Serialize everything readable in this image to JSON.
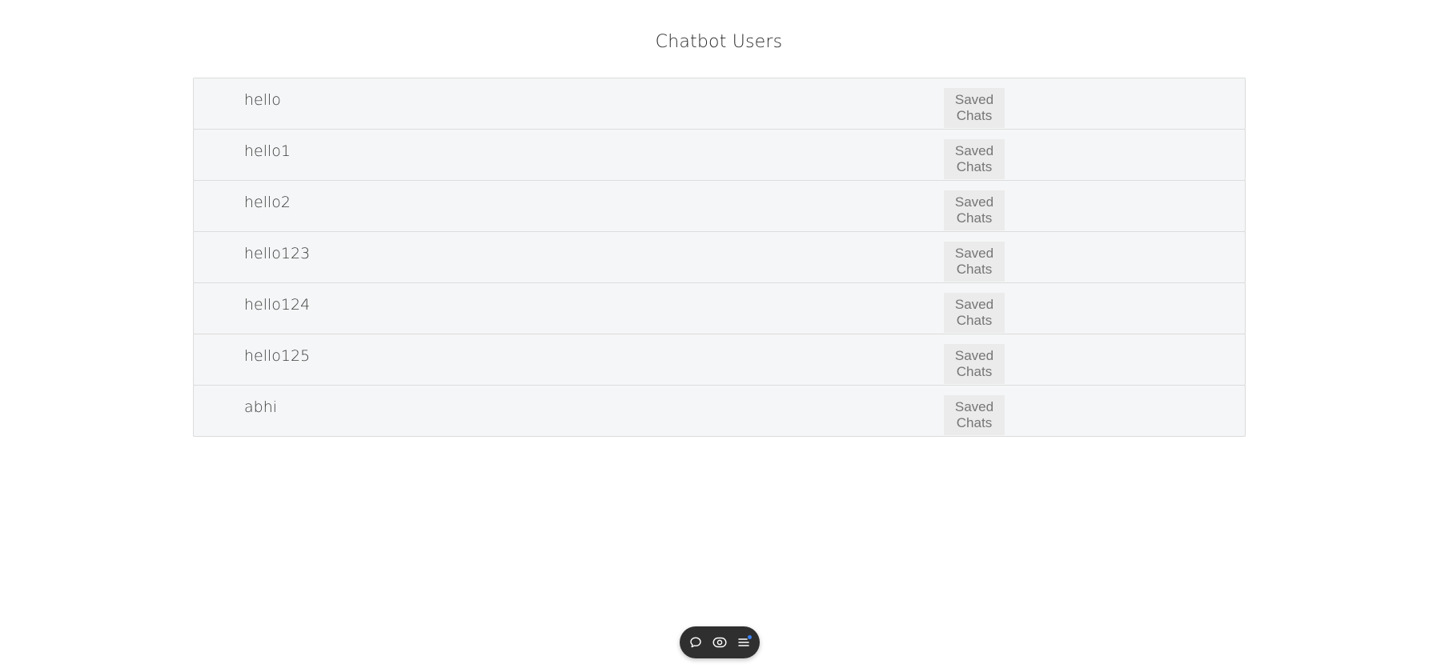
{
  "header": {
    "title": "Chatbot Users"
  },
  "users": [
    {
      "username": "hello",
      "action_label": "Saved Chats"
    },
    {
      "username": "hello1",
      "action_label": "Saved Chats"
    },
    {
      "username": "hello2",
      "action_label": "Saved Chats"
    },
    {
      "username": "hello123",
      "action_label": "Saved Chats"
    },
    {
      "username": "hello124",
      "action_label": "Saved Chats"
    },
    {
      "username": "hello125",
      "action_label": "Saved Chats"
    },
    {
      "username": "abhi",
      "action_label": "Saved Chats"
    }
  ],
  "toolbar": {
    "icons": [
      "chat-bubble-icon",
      "eye-toggle-icon",
      "menu-icon"
    ],
    "notification_color": "#3b82f6"
  }
}
